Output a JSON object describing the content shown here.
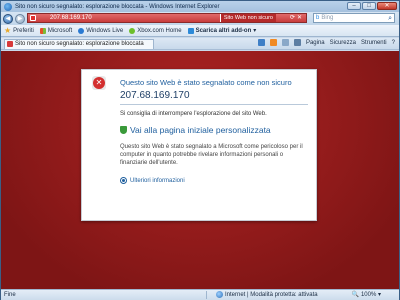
{
  "window": {
    "title": "Sito non sicuro segnalato: esplorazione bloccata - Windows Internet Explorer",
    "controls": [
      "–",
      "□",
      "✕"
    ]
  },
  "addressbar": {
    "url": "207.68.169.170",
    "security_badge": "Sito Web non sicuro",
    "search_placeholder": "Bing",
    "search_engine_icon": "bing-icon"
  },
  "favorites_bar": {
    "favorites_label": "Preferiti",
    "items": [
      {
        "label": "Microsoft",
        "icon": "microsoft-icon"
      },
      {
        "label": "Windows Live",
        "icon": "windows-live-icon"
      },
      {
        "label": "Xbox.com Home",
        "icon": "xbox-icon"
      },
      {
        "label": "Scarica altri add-on",
        "icon": "download-icon"
      }
    ]
  },
  "tab": {
    "title": "Sito non sicuro segnalato: esplorazione bloccata"
  },
  "command_bar": {
    "page": "Pagina",
    "safety": "Sicurezza",
    "tools": "Strumenti",
    "help": "?"
  },
  "warning": {
    "heading": "Questo sito Web è stato segnalato come non sicuro",
    "ip": "207.68.169.170",
    "advice": "Si consiglia di interrompere l'esplorazione del sito Web.",
    "home_link": "Vai alla pagina iniziale personalizzata",
    "explanation": "Questo sito Web è stato segnalato a Microsoft come pericoloso per il computer in quanto potrebbe rivelare informazioni personali o finanziarie dell'utente.",
    "more_info": "Ulteriori informazioni"
  },
  "statusbar": {
    "status": "Fine",
    "zone": "Internet | Modalità protetta: attivata",
    "zoom": "100%"
  },
  "colors": {
    "danger_background": "#9a1c1c",
    "link_blue": "#1f5f9e",
    "chrome_blue": "#c9d9ea"
  }
}
